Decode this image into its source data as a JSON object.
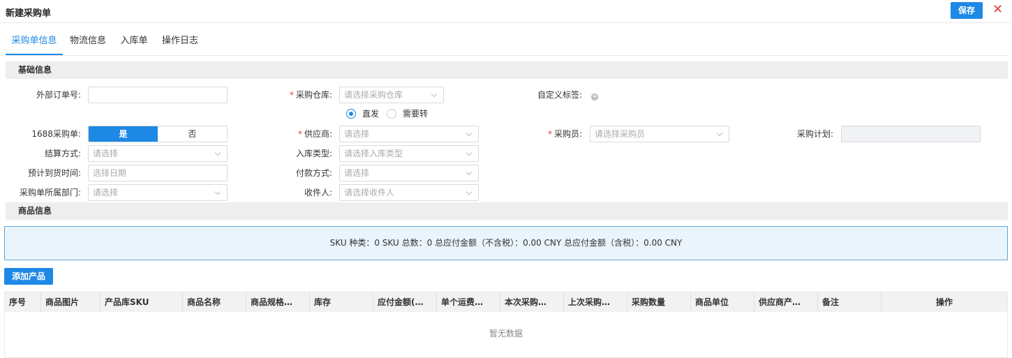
{
  "header": {
    "title": "新建采购单",
    "save_label": "保存",
    "close_label": "✕"
  },
  "tabs": [
    {
      "label": "采购单信息",
      "active": true
    },
    {
      "label": "物流信息",
      "active": false
    },
    {
      "label": "入库单",
      "active": false
    },
    {
      "label": "操作日志",
      "active": false
    }
  ],
  "basic": {
    "title": "基础信息",
    "external_order": {
      "label": "外部订单号:",
      "value": ""
    },
    "warehouse": {
      "label": "采购仓库:",
      "placeholder": "请选择采购仓库"
    },
    "custom_tag": {
      "label": "自定义标签:"
    },
    "ship_mode": {
      "option1": "直发",
      "option2": "需要转",
      "selected": "直发"
    },
    "is_1688": {
      "label": "1688采购单:",
      "yes": "是",
      "no": "否",
      "selected": "是"
    },
    "supplier": {
      "label": "供应商:",
      "placeholder": "请选择"
    },
    "buyer": {
      "label": "采购员:",
      "placeholder": "请选择采购员"
    },
    "plan": {
      "label": "采购计划:",
      "value": ""
    },
    "settle": {
      "label": "结算方式:",
      "placeholder": "请选择"
    },
    "stock_type": {
      "label": "入库类型:",
      "placeholder": "请选择入库类型"
    },
    "eta": {
      "label": "预计到货时间:",
      "placeholder": "选择日期"
    },
    "payment": {
      "label": "付款方式:",
      "placeholder": "请选择"
    },
    "dept": {
      "label": "采购单所属部门:",
      "placeholder": "请选择"
    },
    "receiver": {
      "label": "收件人:",
      "placeholder": "请选择收件人"
    }
  },
  "goods": {
    "title": "商品信息",
    "summary": "SKU 种类：0 SKU 总数：0 总应付金额（不含税）：0.00 CNY 总应付金额（含税）：0.00 CNY",
    "add_label": "添加产品",
    "columns": [
      "序号",
      "商品图片",
      "产品库SKU",
      "商品名称",
      "商品规格…",
      "库存",
      "应付金额(…",
      "单个运费…",
      "本次采购…",
      "上次采购…",
      "采购数量",
      "商品单位",
      "供应商产…",
      "备注",
      "操作"
    ],
    "empty": "暂无数据"
  },
  "colors": {
    "primary": "#1e88e5",
    "danger": "#e53935",
    "summary_bg": "#eaf4fc"
  }
}
